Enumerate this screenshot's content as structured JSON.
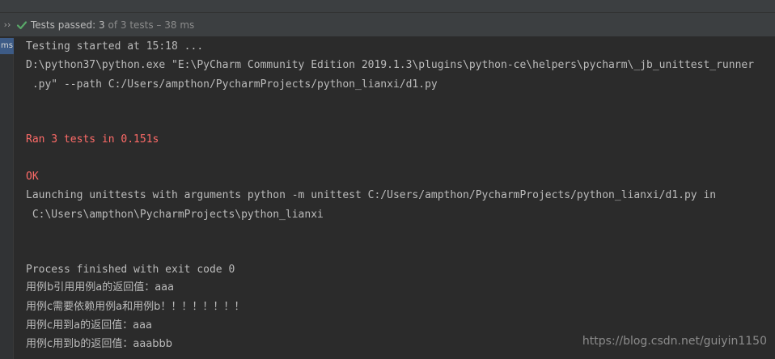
{
  "status": {
    "expand_glyph": "››",
    "icon": "check-icon",
    "passed_label": "Tests passed: 3",
    "total_label": " of 3 tests – 38 ms",
    "accent_color": "#59a869"
  },
  "gutter": {
    "tab_label": "ms"
  },
  "console": {
    "lines": [
      "Testing started at 15:18 ...",
      "D:\\python37\\python.exe \"E:\\PyCharm Community Edition 2019.1.3\\plugins\\python-ce\\helpers\\pycharm\\_jb_unittest_runner",
      " .py\" --path C:/Users/ampthon/PycharmProjects/python_lianxi/d1.py",
      "Ran 3 tests in 0.151s",
      "OK",
      "Launching unittests with arguments python -m unittest C:/Users/ampthon/PycharmProjects/python_lianxi/d1.py in",
      " C:\\Users\\ampthon\\PycharmProjects\\python_lianxi",
      "Process finished with exit code 0",
      "用例b引用用例a的返回值：aaa",
      "用例c需要依赖用例a和用例b！！！！！！！！",
      "用例c用到a的返回值：aaa",
      "用例c用到b的返回值：aaabbb"
    ],
    "stderr_color": "#ff6b68",
    "text_color": "#bbbbbb"
  },
  "watermark": "https://blog.csdn.net/guiyin1150"
}
